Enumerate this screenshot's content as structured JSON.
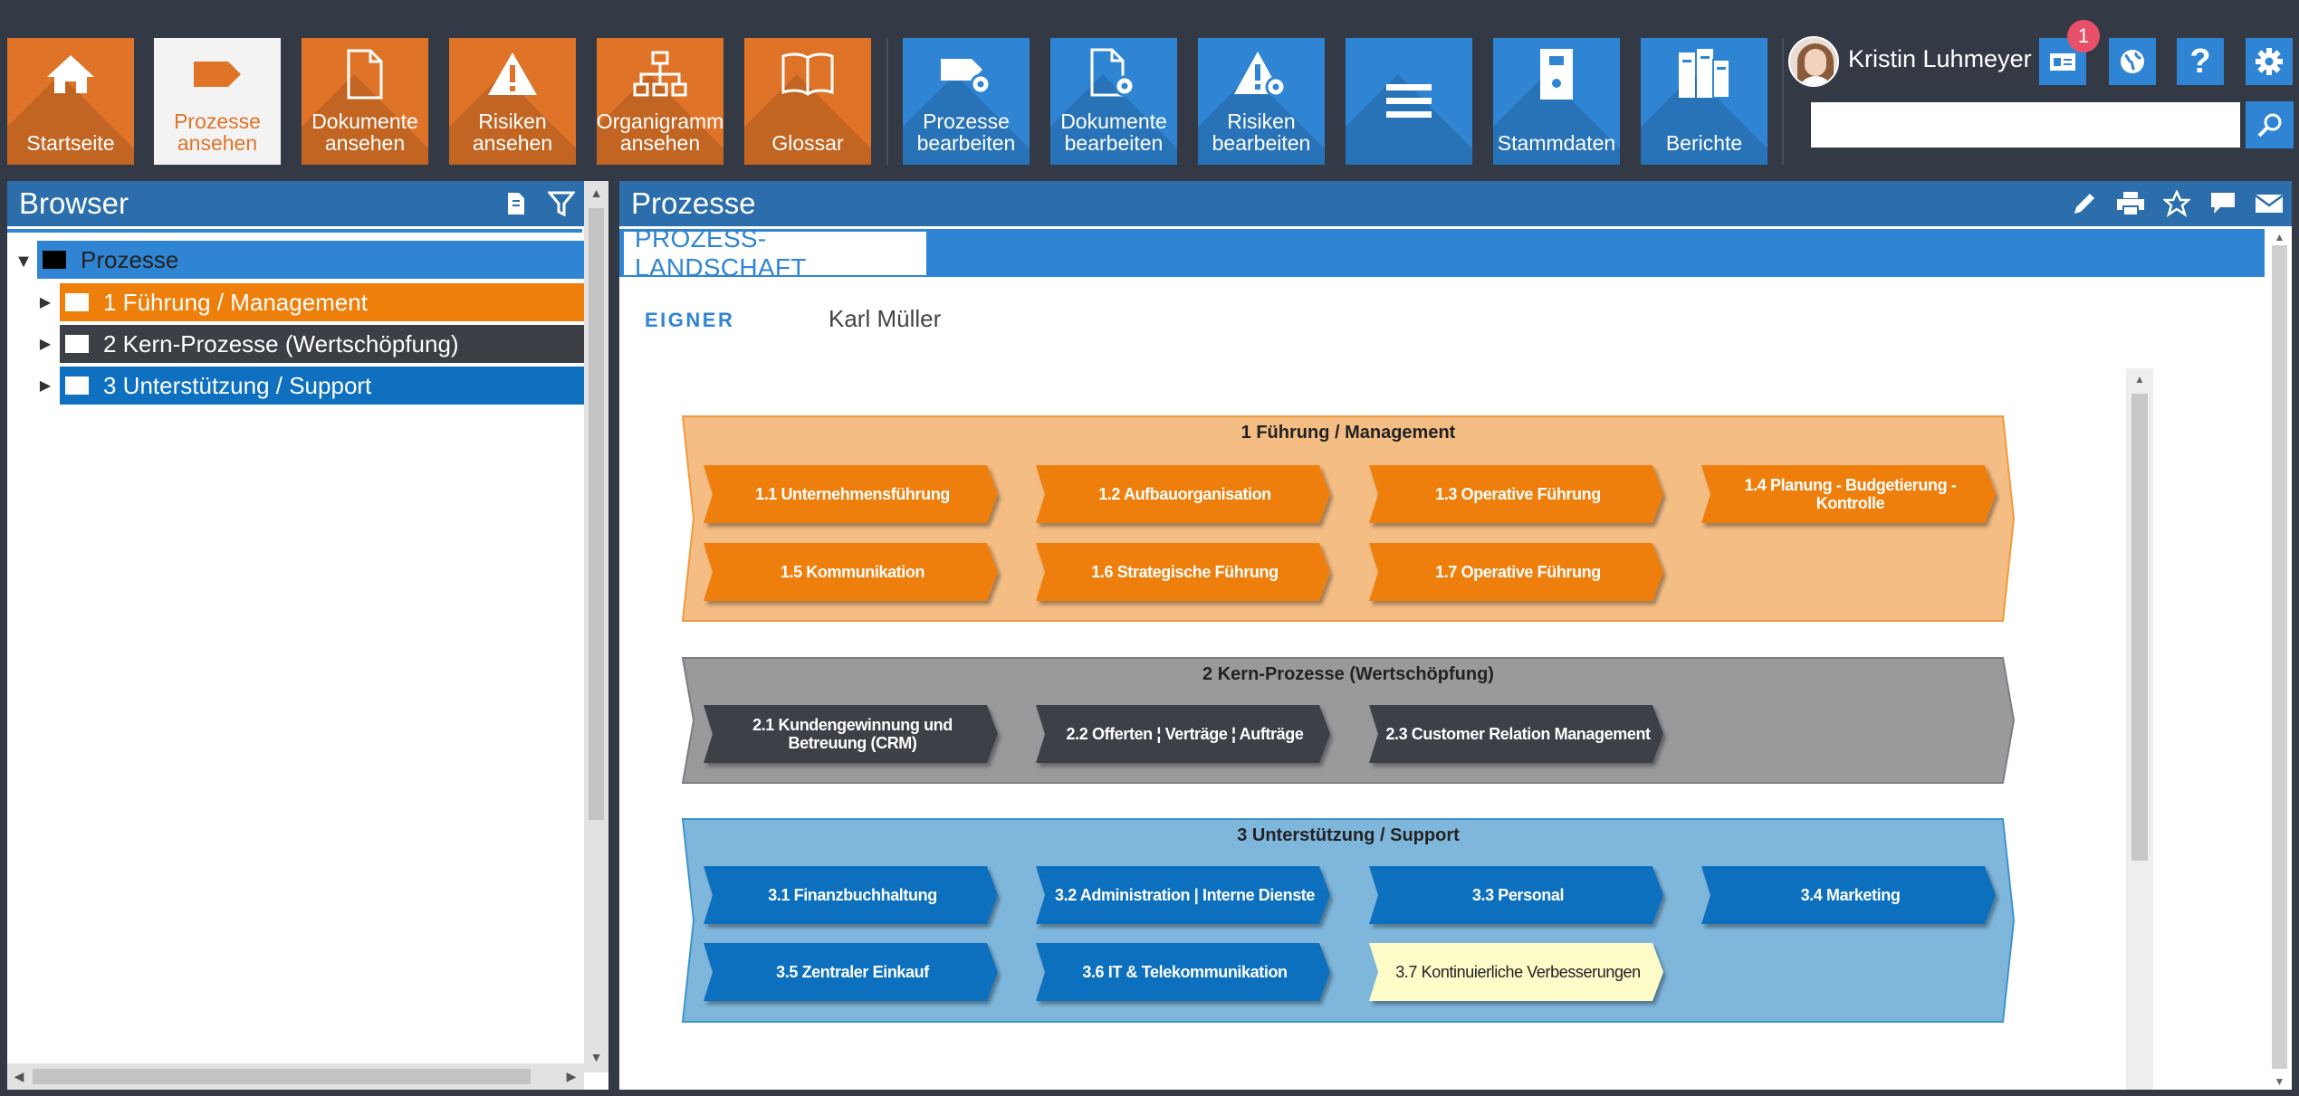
{
  "toolbar": {
    "startseite": "Startseite",
    "prozesse_ansehen": [
      "Prozesse",
      "ansehen"
    ],
    "dokumente_ansehen": [
      "Dokumente",
      "ansehen"
    ],
    "risiken_ansehen": [
      "Risiken",
      "ansehen"
    ],
    "organigramm_ansehen": [
      "Organigramm",
      "ansehen"
    ],
    "glossar": "Glossar",
    "prozesse_bearbeiten": [
      "Prozesse",
      "bearbeiten"
    ],
    "dokumente_bearbeiten": [
      "Dokumente",
      "bearbeiten"
    ],
    "risiken_bearbeiten": [
      "Risiken",
      "bearbeiten"
    ],
    "stammdaten": "Stammdaten",
    "berichte": "Berichte"
  },
  "user": {
    "name": "Kristin Luhmeyer",
    "notifications": "1"
  },
  "search": {
    "value": "",
    "placeholder": ""
  },
  "browser": {
    "title": "Browser",
    "tree": {
      "root": "Prozesse",
      "children": [
        "1 Führung / Management",
        "2 Kern-Prozesse (Wertschöpfung)",
        "3 Unterstützung / Support"
      ]
    }
  },
  "content": {
    "title": "Prozesse",
    "tab": "PROZESS-LANDSCHAFT",
    "owner_label": "EIGNER",
    "owner_value": "Karl Müller"
  },
  "landscape": [
    {
      "title": "1 Führung / Management",
      "color": "#f4bd84",
      "border": "#f09a3e",
      "arrow_color": "#ef7f0b",
      "items": [
        {
          "label": [
            "1.1 Unternehmensführung"
          ]
        },
        {
          "label": [
            "1.2 Aufbauorganisation"
          ]
        },
        {
          "label": [
            "1.3 Operative Führung"
          ]
        },
        {
          "label": [
            "1.4 Planung - Budgetierung -",
            "Kontrolle"
          ]
        },
        {
          "label": [
            "1.5 Kommunikation"
          ]
        },
        {
          "label": [
            "1.6 Strategische Führung"
          ]
        },
        {
          "label": [
            "1.7 Operative Führung"
          ]
        }
      ]
    },
    {
      "title": "2 Kern-Prozesse (Wertschöpfung)",
      "color": "#9a9a9d",
      "border": "#7d7e82",
      "arrow_color": "#3c3f46",
      "items": [
        {
          "label": [
            "2.1 Kundengewinnung und",
            "Betreuung (CRM)"
          ]
        },
        {
          "label": [
            "2.2 Offerten ¦  Verträge ¦ Aufträge"
          ]
        },
        {
          "label": [
            "2.3 Customer Relation Management"
          ]
        }
      ]
    },
    {
      "title": "3 Unterstützung / Support",
      "color": "#7fb7dc",
      "border": "#3f93cc",
      "arrow_color": "#0e70bf",
      "items": [
        {
          "label": [
            "3.1 Finanzbuchhaltung"
          ]
        },
        {
          "label": [
            "3.2 Administration | Interne Dienste"
          ]
        },
        {
          "label": [
            "3.3 Personal"
          ]
        },
        {
          "label": [
            "3.4 Marketing"
          ]
        },
        {
          "label": [
            "3.5 Zentraler Einkauf"
          ]
        },
        {
          "label": [
            "3.6 IT & Telekommunikation"
          ]
        },
        {
          "label": [
            "3.7 Kontinuierliche Verbesserungen"
          ],
          "highlight": "#fdfbc8"
        }
      ]
    }
  ]
}
